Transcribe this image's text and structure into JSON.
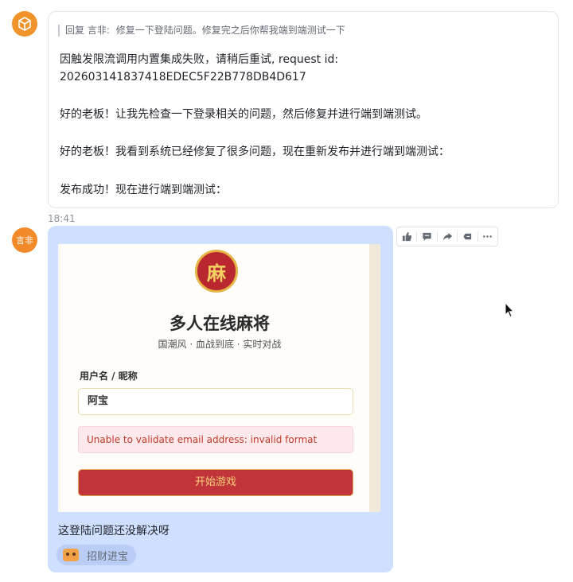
{
  "bot_message": {
    "reply_prefix": "回复 言非:",
    "reply_text": "修复一下登陆问题。修复完之后你帮我端到端测试一下",
    "lines": [
      "因触发限流调用内置集成失败，请稍后重试, request id:",
      "202603141837418EDEC5F22B778DB4D617",
      "",
      "好的老板！让我先检查一下登录相关的问题，然后修复并进行端到端测试。",
      "",
      "好的老板！我看到系统已经修复了很多问题，现在重新发布并进行端到端测试：",
      "",
      "发布成功！现在进行端到端测试："
    ],
    "time": "18:41"
  },
  "user": {
    "avatar_text": "言非"
  },
  "screenshot": {
    "badge": "麻",
    "title": "多人在线麻将",
    "subtitle": "国潮风 · 血战到底 · 实时对战",
    "field_label": "用户名 / 昵称",
    "field_value": "阿宝",
    "error": "Unable to validate email address: invalid format",
    "button": "开始游戏"
  },
  "user_message": {
    "text": "这登陆问题还没解决呀",
    "reaction_label": "招财进宝"
  },
  "toolbar": {
    "icons": [
      "thumbs-up-icon",
      "comment-icon",
      "forward-icon",
      "pin-icon",
      "more-icon"
    ]
  },
  "colors": {
    "bot_avatar": "#f0932a",
    "user_bubble": "#cfdfff",
    "mj_red": "#c0343a",
    "mj_gold": "#f6d27a",
    "error_text": "#c0392b"
  }
}
